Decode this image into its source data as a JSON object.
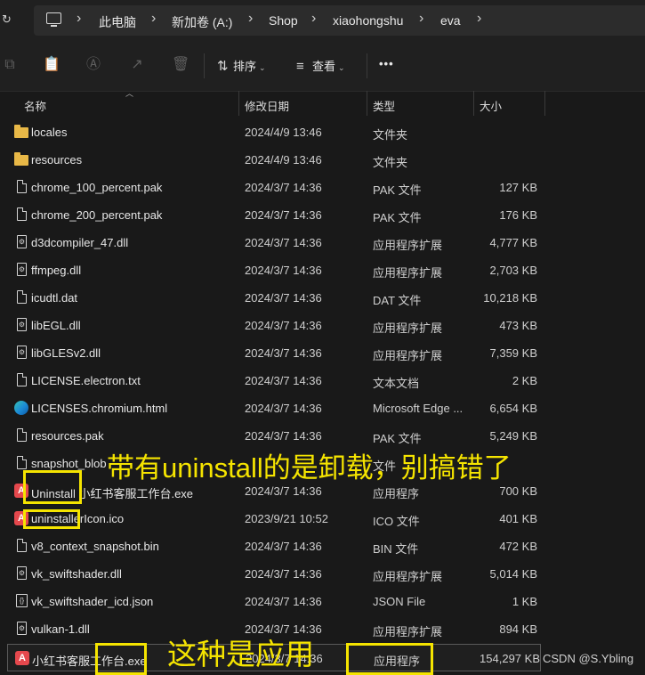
{
  "address_bar": {
    "breadcrumbs": [
      "此电脑",
      "新加卷 (A:)",
      "Shop",
      "xiaohongshu",
      "eva"
    ]
  },
  "toolbar": {
    "sort_label": "排序",
    "view_label": "查看",
    "more_label": "•••"
  },
  "columns": {
    "name": "名称",
    "modified": "修改日期",
    "type": "类型",
    "size": "大小"
  },
  "files": [
    {
      "name": "locales",
      "modified": "2024/4/9 13:46",
      "type": "文件夹",
      "size": "",
      "icon": "folder-icon"
    },
    {
      "name": "resources",
      "modified": "2024/4/9 13:46",
      "type": "文件夹",
      "size": "",
      "icon": "folder-icon"
    },
    {
      "name": "chrome_100_percent.pak",
      "modified": "2024/3/7 14:36",
      "type": "PAK 文件",
      "size": "127 KB",
      "icon": "file-icon"
    },
    {
      "name": "chrome_200_percent.pak",
      "modified": "2024/3/7 14:36",
      "type": "PAK 文件",
      "size": "176 KB",
      "icon": "file-icon"
    },
    {
      "name": "d3dcompiler_47.dll",
      "modified": "2024/3/7 14:36",
      "type": "应用程序扩展",
      "size": "4,777 KB",
      "icon": "dll-icon"
    },
    {
      "name": "ffmpeg.dll",
      "modified": "2024/3/7 14:36",
      "type": "应用程序扩展",
      "size": "2,703 KB",
      "icon": "dll-icon"
    },
    {
      "name": "icudtl.dat",
      "modified": "2024/3/7 14:36",
      "type": "DAT 文件",
      "size": "10,218 KB",
      "icon": "file-icon"
    },
    {
      "name": "libEGL.dll",
      "modified": "2024/3/7 14:36",
      "type": "应用程序扩展",
      "size": "473 KB",
      "icon": "dll-icon"
    },
    {
      "name": "libGLESv2.dll",
      "modified": "2024/3/7 14:36",
      "type": "应用程序扩展",
      "size": "7,359 KB",
      "icon": "dll-icon"
    },
    {
      "name": "LICENSE.electron.txt",
      "modified": "2024/3/7 14:36",
      "type": "文本文档",
      "size": "2 KB",
      "icon": "file-icon"
    },
    {
      "name": "LICENSES.chromium.html",
      "modified": "2024/3/7 14:36",
      "type": "Microsoft Edge ...",
      "size": "6,654 KB",
      "icon": "edge-icon"
    },
    {
      "name": "resources.pak",
      "modified": "2024/3/7 14:36",
      "type": "PAK 文件",
      "size": "5,249 KB",
      "icon": "file-icon"
    },
    {
      "name": "snapshot_blob",
      "modified": "",
      "type": "文件",
      "size": "",
      "icon": "file-icon"
    },
    {
      "name": "Uninstall 小红书客服工作台.exe",
      "modified": "2024/3/7 14:36",
      "type": "应用程序",
      "size": "700 KB",
      "icon": "app-red-icon"
    },
    {
      "name": "uninstallerIcon.ico",
      "modified": "2023/9/21 10:52",
      "type": "ICO 文件",
      "size": "401 KB",
      "icon": "app-red-icon"
    },
    {
      "name": "v8_context_snapshot.bin",
      "modified": "2024/3/7 14:36",
      "type": "BIN 文件",
      "size": "472 KB",
      "icon": "file-icon"
    },
    {
      "name": "vk_swiftshader.dll",
      "modified": "2024/3/7 14:36",
      "type": "应用程序扩展",
      "size": "5,014 KB",
      "icon": "dll-icon"
    },
    {
      "name": "vk_swiftshader_icd.json",
      "modified": "2024/3/7 14:36",
      "type": "JSON File",
      "size": "1 KB",
      "icon": "json-icon"
    },
    {
      "name": "vulkan-1.dll",
      "modified": "2024/3/7 14:36",
      "type": "应用程序扩展",
      "size": "894 KB",
      "icon": "dll-icon"
    },
    {
      "name": "小红书客服工作台.exe",
      "modified": "2024/3/7 14:36",
      "type": "应用程序",
      "size": "154,297 KB",
      "icon": "app-red-icon"
    }
  ],
  "annotations": {
    "uninstall_note": "带有uninstall的是卸载，别搞错了",
    "app_note": "这种是应用",
    "highlight_color": "#f5e400"
  },
  "watermark": "CSDN @S.Ybling"
}
